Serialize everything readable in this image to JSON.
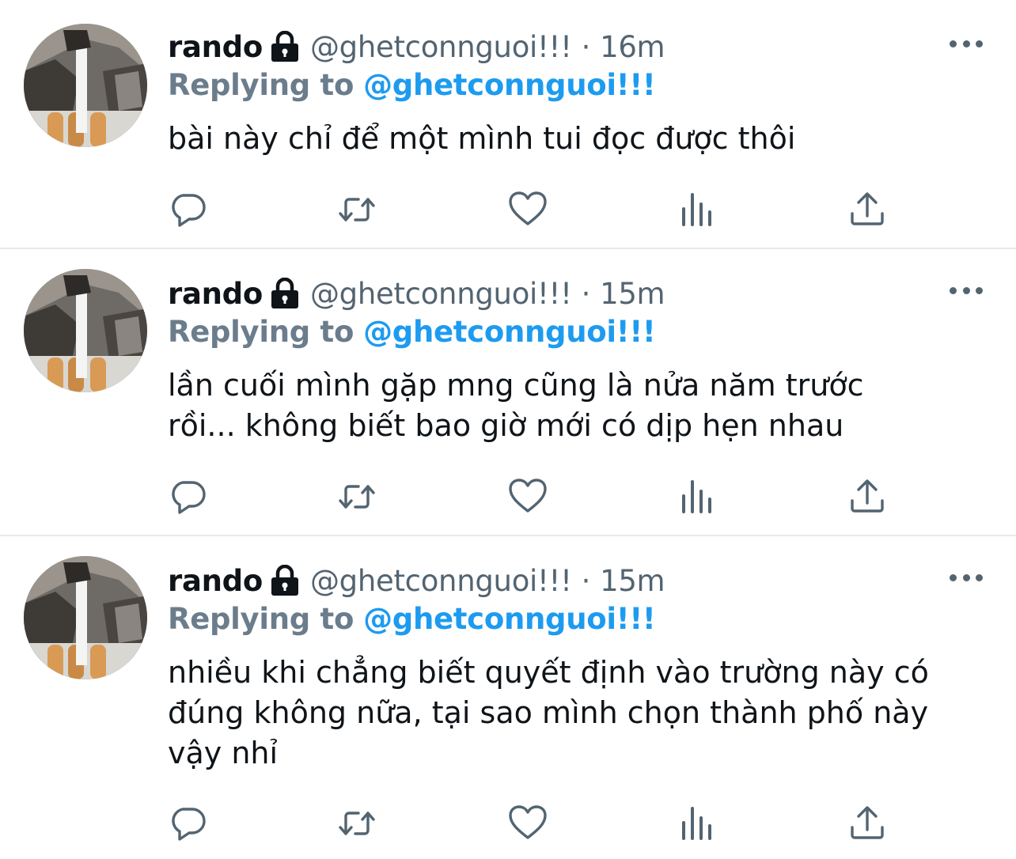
{
  "tweets": [
    {
      "author_name": "rando",
      "handle": "@ghetconnguoi!!!",
      "separator": "·",
      "time": "16m",
      "reply_label": "Replying to",
      "reply_to": "@ghetconnguoi!!!",
      "text": "bài này chỉ để một mình tui đọc được thôi"
    },
    {
      "author_name": "rando",
      "handle": "@ghetconnguoi!!!",
      "separator": "·",
      "time": "15m",
      "reply_label": "Replying to",
      "reply_to": "@ghetconnguoi!!!",
      "text_lines": [
        "lần cuối mình gặp mng cũng là nửa năm trước",
        "rồi... không biết bao giờ mới có dịp hẹn nhau"
      ]
    },
    {
      "author_name": "rando",
      "handle": "@ghetconnguoi!!!",
      "separator": "·",
      "time": "15m",
      "reply_label": "Replying to",
      "reply_to": "@ghetconnguoi!!!",
      "text_lines": [
        "nhiều khi chẳng biết quyết định vào trường này có",
        "đúng không nữa, tại sao mình chọn thành phố này",
        "vậy nhỉ"
      ]
    }
  ],
  "icons": {
    "protected": "lock-icon",
    "more": "more-dots-icon",
    "actions": [
      "reply-icon",
      "retweet-icon",
      "like-icon",
      "analytics-icon",
      "share-icon"
    ]
  },
  "colors": {
    "text": "#0f1419",
    "secondary": "#536471",
    "link": "#1d9bf0",
    "icon": "#536471",
    "divider": "#e7eaed"
  }
}
